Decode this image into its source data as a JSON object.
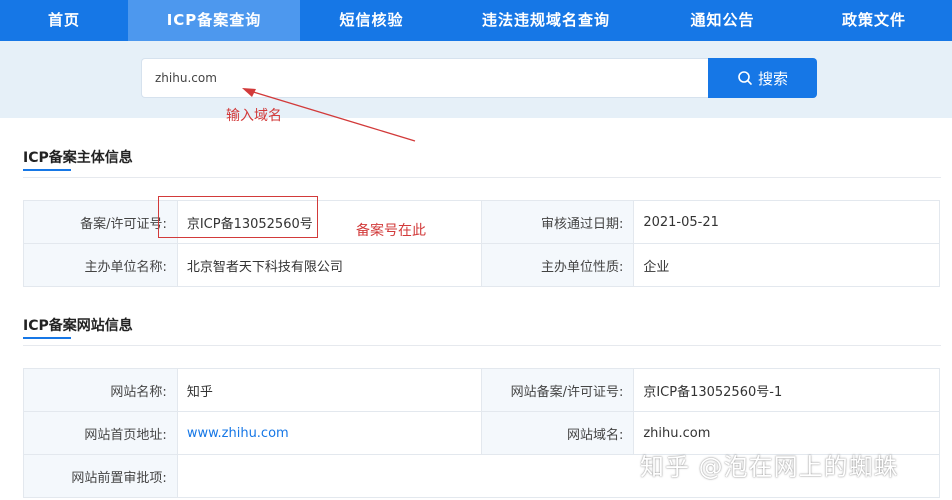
{
  "nav": {
    "items": [
      {
        "label": "首页"
      },
      {
        "label": "ICP备案查询"
      },
      {
        "label": "短信核验"
      },
      {
        "label": "违法违规域名查询"
      },
      {
        "label": "通知公告"
      },
      {
        "label": "政策文件"
      }
    ],
    "active_index": 1
  },
  "search": {
    "value": "zhihu.com",
    "button_label": "搜索"
  },
  "annotations": {
    "input_hint": "输入域名",
    "record_hint": "备案号在此"
  },
  "entity_section": {
    "title": "ICP备案主体信息",
    "rows": [
      {
        "label1": "备案/许可证号:",
        "value1": "京ICP备13052560号",
        "label2": "审核通过日期:",
        "value2": "2021-05-21"
      },
      {
        "label1": "主办单位名称:",
        "value1": "北京智者天下科技有限公司",
        "label2": "主办单位性质:",
        "value2": "企业"
      }
    ]
  },
  "site_section": {
    "title": "ICP备案网站信息",
    "rows": [
      {
        "label1": "网站名称:",
        "value1": "知乎",
        "label2": "网站备案/许可证号:",
        "value2": "京ICP备13052560号-1"
      },
      {
        "label1": "网站首页地址:",
        "value1": "www.zhihu.com",
        "label2": "网站域名:",
        "value2": "zhihu.com"
      },
      {
        "label1": "网站前置审批项:",
        "value1": "",
        "label2": "",
        "value2": ""
      }
    ]
  },
  "watermark": "知乎 @泡在网上的蜘蛛",
  "colors": {
    "primary": "#1677e6",
    "nav_active": "#4d98ee",
    "annotation_red": "#d23a3a",
    "band": "#e6f0f8"
  }
}
